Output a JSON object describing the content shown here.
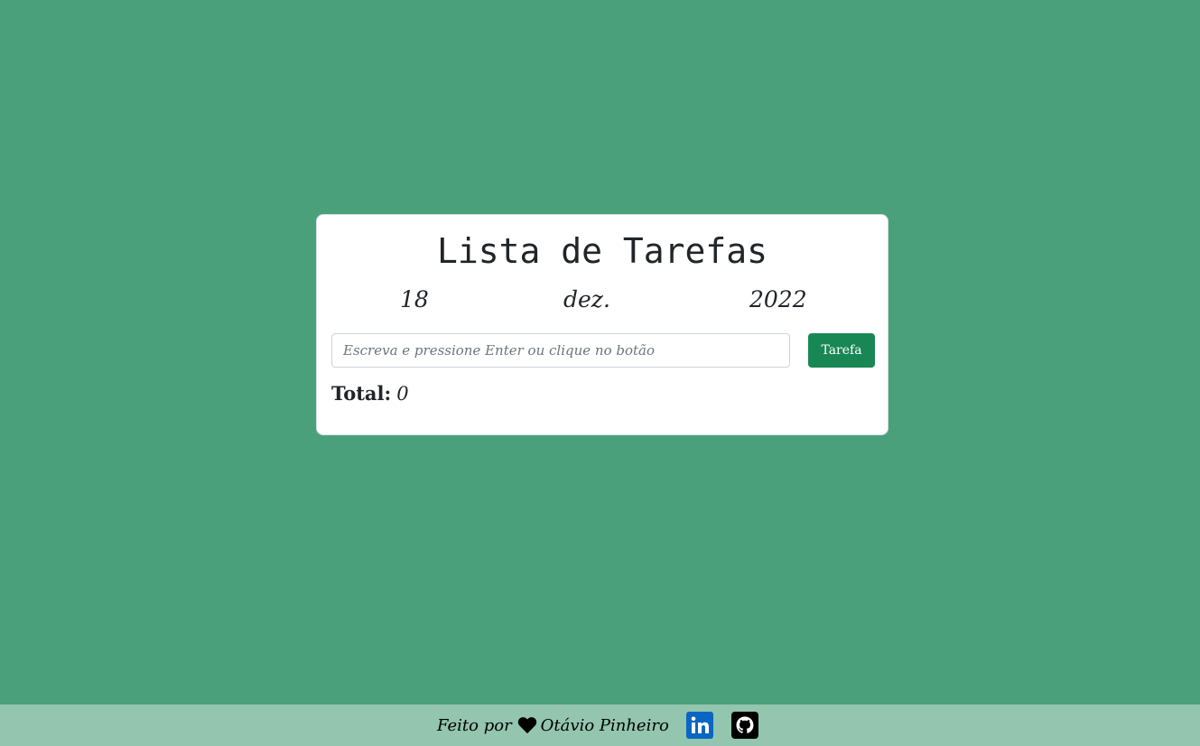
{
  "card": {
    "title": "Lista de Tarefas",
    "date": {
      "day": "18",
      "month": "dez.",
      "year": "2022"
    },
    "input": {
      "placeholder": "Escreva e pressione Enter ou clique no botão",
      "value": ""
    },
    "add_button_label": "Tarefa",
    "total_label": "Total:",
    "total_value": "0"
  },
  "footer": {
    "made_by_text": "Feito por",
    "heart_icon": "heart-icon",
    "author": "Otávio Pinheiro",
    "links": [
      {
        "icon": "linkedin-icon"
      },
      {
        "icon": "github-icon"
      }
    ]
  },
  "colors": {
    "background": "#49a07b",
    "footer_background": "#93c5af",
    "button": "#198754",
    "linkedin": "#0a66c2"
  }
}
